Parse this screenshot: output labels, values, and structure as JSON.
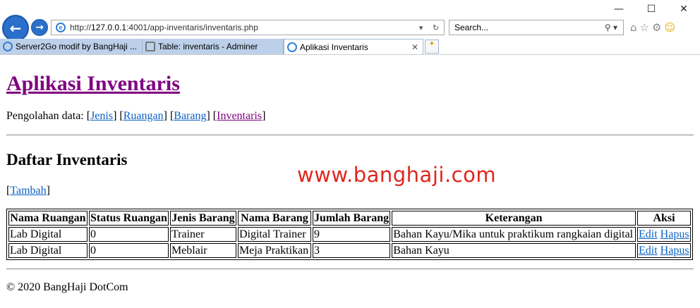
{
  "browser": {
    "url_prefix": "http://",
    "url_host": "127.0.0.1",
    "url_rest": ":4001/app-inventaris/inventaris.php",
    "search_placeholder": "Search...",
    "tabs": [
      {
        "label": "Server2Go modif by BangHaji ..."
      },
      {
        "label": "Table: inventaris - Adminer"
      },
      {
        "label": "Aplikasi Inventaris"
      }
    ]
  },
  "page": {
    "title": "Aplikasi Inventaris",
    "menu_prefix": "Pengolahan data:",
    "menu": [
      "Jenis",
      "Ruangan",
      "Barang",
      "Inventaris"
    ],
    "section_title": "Daftar Inventaris",
    "add_label": "Tambah",
    "watermark": "www.banghaji.com",
    "table": {
      "headers": [
        "Nama Ruangan",
        "Status Ruangan",
        "Jenis Barang",
        "Nama Barang",
        "Jumlah Barang",
        "Keterangan",
        "Aksi"
      ],
      "rows": [
        {
          "ruangan": "Lab Digital",
          "status": "0",
          "jenis": "Trainer",
          "nama": "Digital Trainer",
          "jumlah": "9",
          "keterangan": "Bahan Kayu/Mika untuk praktikum rangkaian digital"
        },
        {
          "ruangan": "Lab Digital",
          "status": "0",
          "jenis": "Meblair",
          "nama": "Meja Praktikan",
          "jumlah": "3",
          "keterangan": "Bahan Kayu"
        }
      ],
      "edit_label": "Edit",
      "delete_label": "Hapus"
    },
    "footer": "© 2020 BangHaji DotCom"
  }
}
